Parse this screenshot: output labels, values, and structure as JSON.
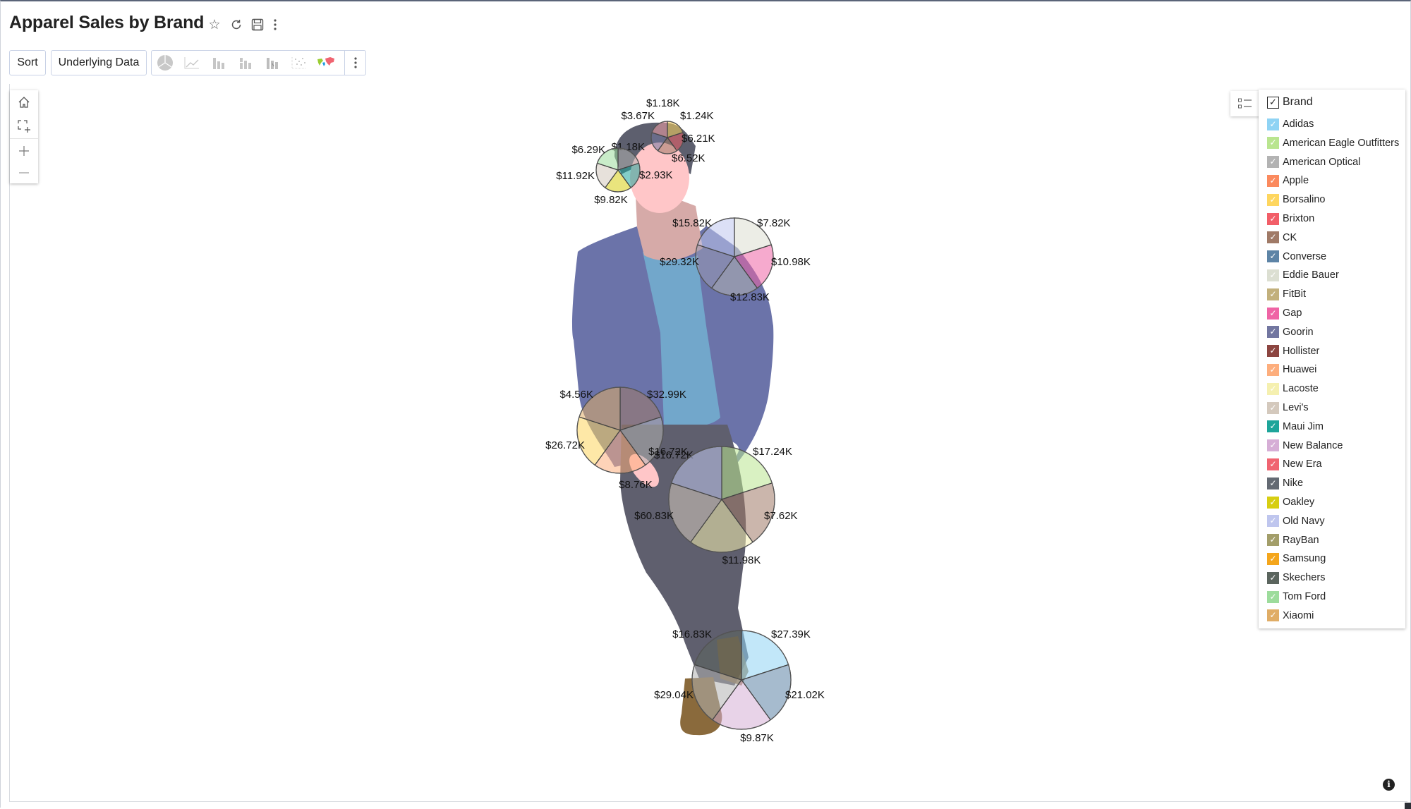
{
  "header": {
    "title": "Apparel Sales by Brand",
    "icons": [
      "star-icon",
      "refresh-icon",
      "save-icon",
      "more-vertical-icon"
    ]
  },
  "toolbar": {
    "sort_label": "Sort",
    "underlying_data_label": "Underlying Data",
    "chart_types": [
      "pie-chart-icon",
      "line-chart-icon",
      "bar-chart-icon",
      "stacked-bar-chart-icon",
      "waterfall-chart-icon",
      "scatter-chart-icon",
      "map-chart-icon"
    ],
    "more_icon": "more-vertical-icon"
  },
  "zoom_tools": [
    "home-icon",
    "zoom-select-icon",
    "zoom-in-icon",
    "zoom-out-icon"
  ],
  "legend": {
    "title": "Brand",
    "all_checked": true,
    "items": [
      {
        "label": "Adidas",
        "color": "#8fd3f4"
      },
      {
        "label": "American Eagle Outfitters",
        "color": "#b9e58f"
      },
      {
        "label": "American Optical",
        "color": "#b3b3b3"
      },
      {
        "label": "Apple",
        "color": "#fb8a5e"
      },
      {
        "label": "Borsalino",
        "color": "#fed65f"
      },
      {
        "label": "Brixton",
        "color": "#f25e68"
      },
      {
        "label": "CK",
        "color": "#a07a67"
      },
      {
        "label": "Converse",
        "color": "#5d84a6"
      },
      {
        "label": "Eddie Bauer",
        "color": "#dcdfd2"
      },
      {
        "label": "FitBit",
        "color": "#c2b07c"
      },
      {
        "label": "Gap",
        "color": "#ef64a5"
      },
      {
        "label": "Goorin",
        "color": "#7276a0"
      },
      {
        "label": "Hollister",
        "color": "#8c4540"
      },
      {
        "label": "Huawei",
        "color": "#fdae7d"
      },
      {
        "label": "Lacoste",
        "color": "#f5f0b0"
      },
      {
        "label": "Levi's",
        "color": "#d4c9bd"
      },
      {
        "label": "Maui Jim",
        "color": "#1ea59a"
      },
      {
        "label": "New Balance",
        "color": "#d6aed6"
      },
      {
        "label": "New Era",
        "color": "#f06471"
      },
      {
        "label": "Nike",
        "color": "#646a73"
      },
      {
        "label": "Oakley",
        "color": "#d7ce12"
      },
      {
        "label": "Old Navy",
        "color": "#bfc6ee"
      },
      {
        "label": "RayBan",
        "color": "#a39e6a"
      },
      {
        "label": "Samsung",
        "color": "#f4a61c"
      },
      {
        "label": "Skechers",
        "color": "#5b655e"
      },
      {
        "label": "Tom Ford",
        "color": "#9ddc9c"
      },
      {
        "label": "Xiaomi",
        "color": "#e0ad66"
      }
    ]
  },
  "chart_data": {
    "type": "pie",
    "title": "Apparel Sales by Brand",
    "description": "Multiple pie charts overlaid on a clothing silhouette (hat, glasses, jacket, watch, pants, shoes); each pie shows 5 brand slices labeled in $K.",
    "pies": [
      {
        "name": "hat",
        "labels": [
          "$1.24K",
          "$6.21K",
          "$6.52K",
          "$1.18K",
          "$3.67K"
        ],
        "values": [
          1.24,
          6.21,
          6.52,
          1.18,
          3.67
        ],
        "colors": [
          "#fed65f",
          "#f25e68",
          "#a07a67",
          "#7276a0",
          "#f5a0aa"
        ]
      },
      {
        "name": "glasses",
        "labels": [
          "$1.18K",
          "$2.93K",
          "$9.82K",
          "$11.92K",
          "$6.29K"
        ],
        "values": [
          1.18,
          2.93,
          9.82,
          11.92,
          6.29
        ],
        "colors": [
          "#b3b3b3",
          "#1ea59a",
          "#d7ce12",
          "#d4c9bd",
          "#9ddc9c"
        ]
      },
      {
        "name": "jacket",
        "labels": [
          "$7.82K",
          "$10.98K",
          "$12.83K",
          "$29.32K",
          "$15.82K"
        ],
        "values": [
          7.82,
          10.98,
          12.83,
          29.32,
          15.82
        ],
        "colors": [
          "#dcdfd2",
          "#ef64a5",
          "#b3b3b3",
          "#9a9bb4",
          "#bfc6ee"
        ]
      },
      {
        "name": "watch",
        "labels": [
          "$32.99K",
          "$16.72K",
          "$8.76K",
          "$26.72K",
          "$4.56K"
        ],
        "values": [
          32.99,
          16.72,
          8.76,
          26.72,
          4.56
        ],
        "colors": [
          "#a07a67",
          "#b3b3b3",
          "#fdae7d",
          "#fed65f",
          "#e0ad66"
        ]
      },
      {
        "name": "pants",
        "labels": [
          "$17.24K",
          "$7.62K",
          "$11.98K",
          "$60.83K",
          "$16.72K"
        ],
        "values": [
          17.24,
          7.62,
          11.98,
          60.83,
          16.72
        ],
        "colors": [
          "#b9e58f",
          "#a07a67",
          "#f5f0b0",
          "#d4c9bd",
          "#bfc6ee"
        ]
      },
      {
        "name": "shoes",
        "labels": [
          "$27.39K",
          "$21.02K",
          "$9.87K",
          "$29.04K",
          "$16.83K"
        ],
        "values": [
          27.39,
          21.02,
          9.87,
          29.04,
          16.83
        ],
        "colors": [
          "#8fd3f4",
          "#5d84a6",
          "#d6aed6",
          "#b3b3b3",
          "#5b655e"
        ]
      }
    ]
  }
}
